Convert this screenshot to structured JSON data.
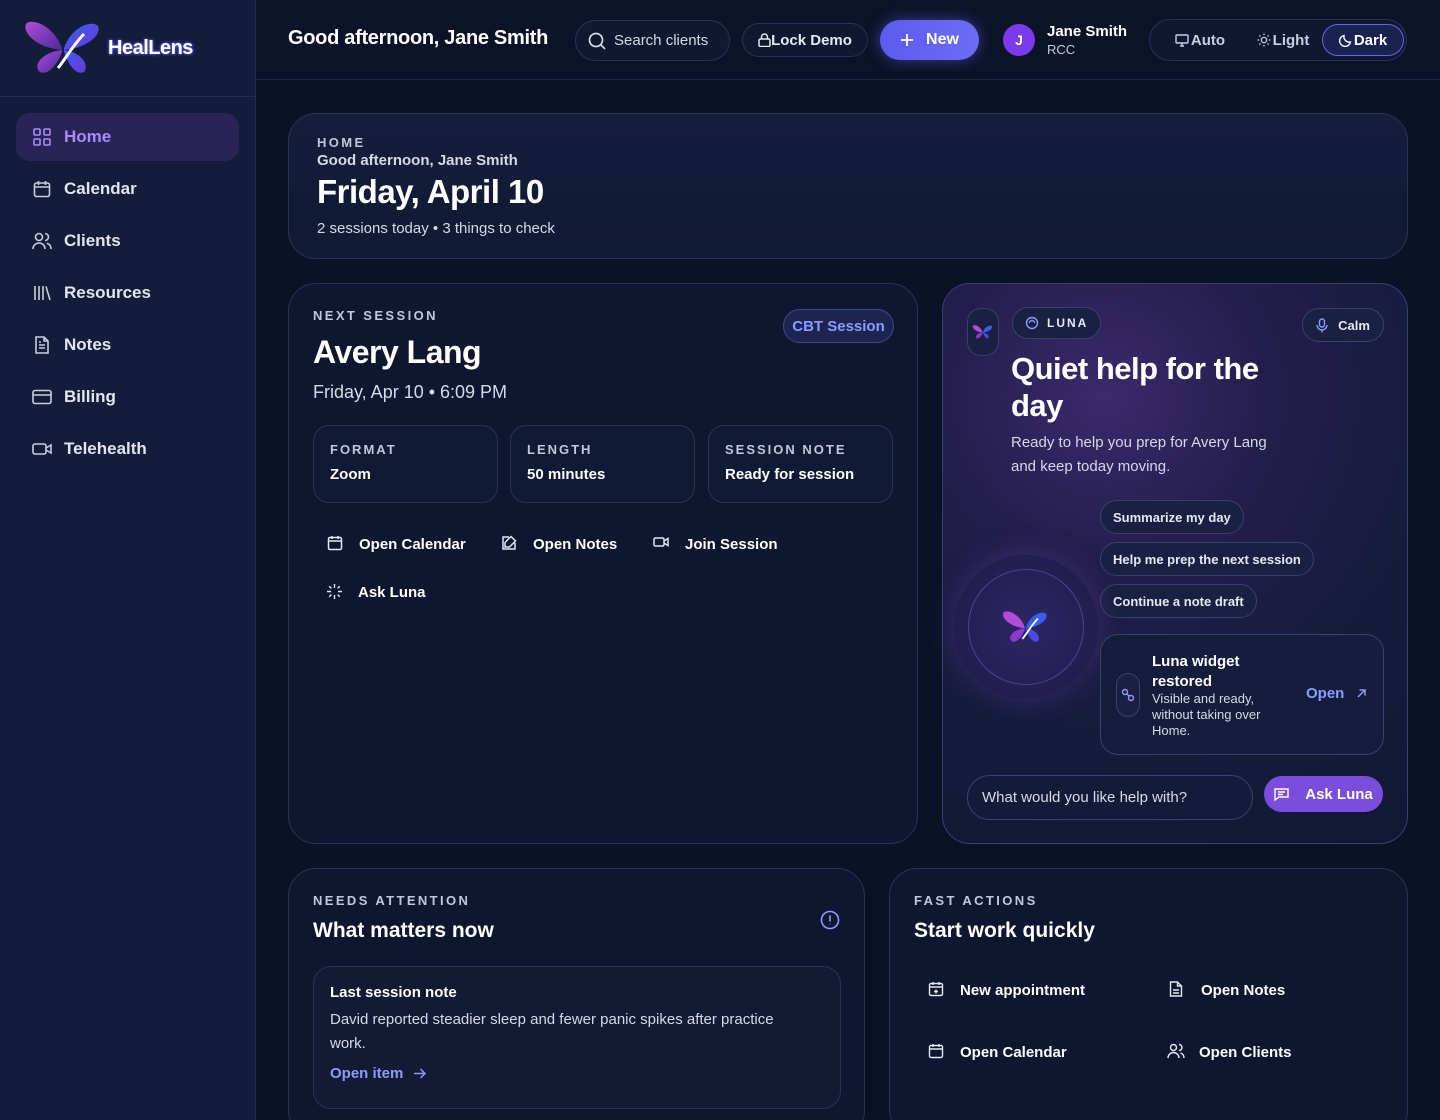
{
  "brand": {
    "name": "HealLens"
  },
  "sidebar": {
    "items": [
      {
        "label": "Home",
        "icon": "grid-icon",
        "active": true
      },
      {
        "label": "Calendar",
        "icon": "calendar-icon"
      },
      {
        "label": "Clients",
        "icon": "users-icon"
      },
      {
        "label": "Resources",
        "icon": "library-icon"
      },
      {
        "label": "Notes",
        "icon": "document-icon"
      },
      {
        "label": "Billing",
        "icon": "credit-card-icon"
      },
      {
        "label": "Telehealth",
        "icon": "video-icon"
      }
    ]
  },
  "topbar": {
    "greeting": "Good afternoon, Jane Smith",
    "search_label": "Search clients",
    "lock_label": "Lock Demo",
    "new_label": "New",
    "user": {
      "initial": "J",
      "name": "Jane Smith",
      "role": "RCC"
    },
    "theme": {
      "options": [
        "Auto",
        "Light",
        "Dark"
      ],
      "selected": "Dark"
    }
  },
  "hero": {
    "eyebrow": "HOME",
    "greeting": "Good afternoon, Jane Smith",
    "date": "Friday, April 10",
    "summary": "2 sessions today • 3 things to check"
  },
  "next_session": {
    "eyebrow": "NEXT SESSION",
    "badge": "CBT Session",
    "client": "Avery Lang",
    "when": "Friday, Apr 10 • 6:09 PM",
    "details": [
      {
        "key": "FORMAT",
        "value": "Zoom"
      },
      {
        "key": "LENGTH",
        "value": "50 minutes"
      },
      {
        "key": "SESSION NOTE",
        "value": "Ready for session"
      }
    ],
    "actions": [
      "Open Calendar",
      "Open Notes",
      "Join Session",
      "Ask Luna"
    ]
  },
  "luna": {
    "tag": "LUNA",
    "mode": "Calm",
    "title_line1": "Quiet help for the",
    "title_line2": "day",
    "desc_line1": "Ready to help you prep for Avery Lang",
    "desc_line2": "and keep today moving.",
    "suggestions": [
      "Summarize my day",
      "Help me prep the next session",
      "Continue a note draft"
    ],
    "restored": {
      "title_line1": "Luna widget",
      "title_line2": "restored",
      "body_line1": "Visible and ready,",
      "body_line2": "without taking over",
      "body_line3": "Home.",
      "open_label": "Open"
    },
    "input_placeholder": "What would you like help with?",
    "ask_label": "Ask Luna"
  },
  "needs_attention": {
    "eyebrow": "NEEDS ATTENTION",
    "title": "What matters now",
    "item": {
      "title": "Last session note",
      "body_line1": "David reported steadier sleep and fewer panic spikes after practice",
      "body_line2": "work.",
      "link": "Open item"
    }
  },
  "fast_actions": {
    "eyebrow": "FAST ACTIONS",
    "title": "Start work quickly",
    "items": [
      "New appointment",
      "Open Notes",
      "Open Calendar",
      "Open Clients"
    ]
  },
  "colors": {
    "accent": "#6366f1",
    "purple": "#a78bfa",
    "bg": "#0b1226"
  }
}
